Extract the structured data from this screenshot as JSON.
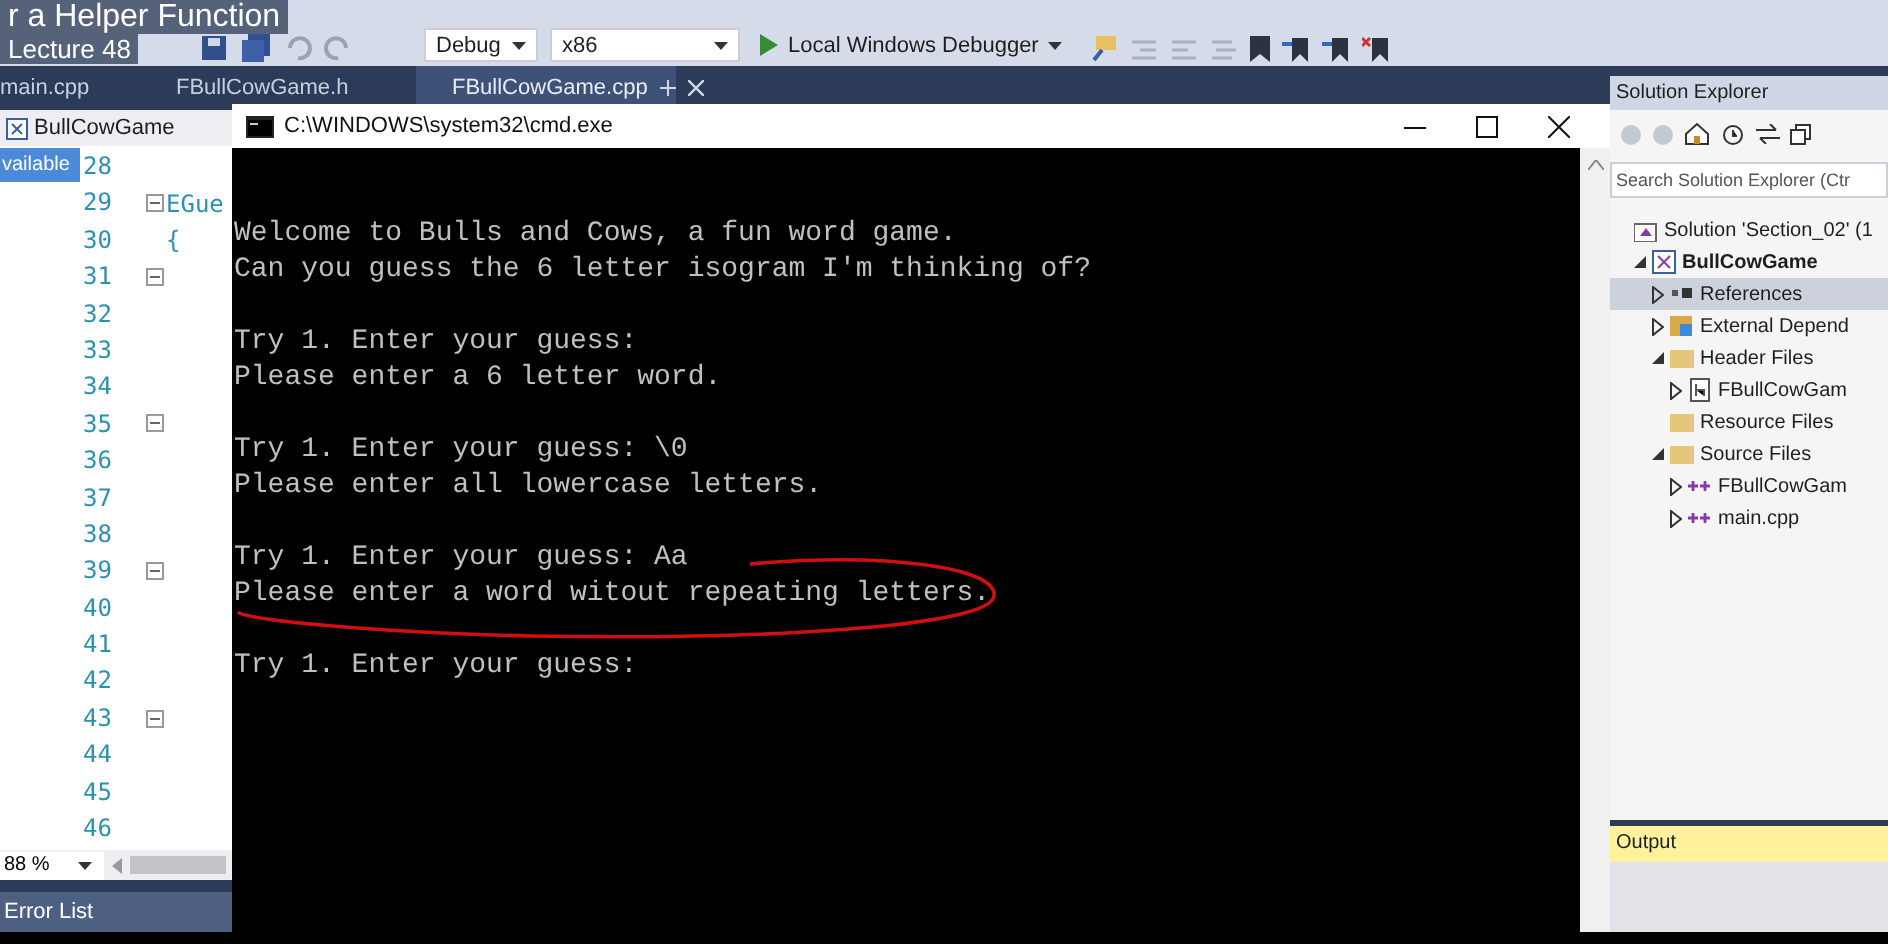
{
  "video_overlay": {
    "title": "r a Helper Function",
    "subtitle": "Lecture 48",
    "banner": "vailable"
  },
  "toolbar": {
    "configuration": "Debug",
    "platform": "x86",
    "debugger": "Local Windows Debugger"
  },
  "document_tabs": [
    {
      "label": "main.cpp",
      "selected": false
    },
    {
      "label": "FBullCowGame.h",
      "selected": false
    },
    {
      "label": "FBullCowGame.cpp",
      "selected": true
    }
  ],
  "editor": {
    "scope": "BullCowGame",
    "lines": [
      {
        "number": "28",
        "fold": false
      },
      {
        "number": "29",
        "fold": true,
        "code": "EGue"
      },
      {
        "number": "30",
        "fold": false,
        "code": "{"
      },
      {
        "number": "31",
        "fold": true
      },
      {
        "number": "32",
        "fold": false
      },
      {
        "number": "33",
        "fold": false
      },
      {
        "number": "34",
        "fold": false
      },
      {
        "number": "35",
        "fold": true
      },
      {
        "number": "36",
        "fold": false
      },
      {
        "number": "37",
        "fold": false
      },
      {
        "number": "38",
        "fold": false
      },
      {
        "number": "39",
        "fold": true
      },
      {
        "number": "40",
        "fold": false
      },
      {
        "number": "41",
        "fold": false
      },
      {
        "number": "42",
        "fold": false
      },
      {
        "number": "43",
        "fold": true
      },
      {
        "number": "44",
        "fold": false
      },
      {
        "number": "45",
        "fold": false
      },
      {
        "number": "46",
        "fold": false
      }
    ],
    "zoom": "88 %"
  },
  "error_list": {
    "title": "Error List"
  },
  "console": {
    "title": "C:\\WINDOWS\\system32\\cmd.exe",
    "paragraphs": [
      [
        {
          "text": "Welcome to Bulls and Cows, a fun word game.",
          "circled": false
        },
        {
          "text": "Can you guess the 6 letter isogram I'm thinking of?",
          "circled": false
        }
      ],
      [
        {
          "text": "Try 1. Enter your guess:",
          "circled": false
        },
        {
          "text": "Please enter a 6 letter word.",
          "circled": false
        }
      ],
      [
        {
          "text": "Try 1. Enter your guess: \\0",
          "circled": false
        },
        {
          "text": "Please enter all lowercase letters.",
          "circled": false
        }
      ],
      [
        {
          "text": "Try 1. Enter your guess: Aa",
          "circled": false
        },
        {
          "text": "Please enter a word witout repeating letters.",
          "circled": true
        }
      ],
      [
        {
          "text": "Try 1. Enter your guess:",
          "circled": false
        }
      ]
    ]
  },
  "solution_explorer": {
    "title": "Solution Explorer",
    "search": {
      "placeholder": "Search Solution Explorer (Ctr"
    },
    "tree": [
      {
        "label": "Solution 'Section_02' (1",
        "kind": "solution",
        "selected": false,
        "children": [
          {
            "label": "BullCowGame",
            "kind": "project",
            "expanded": true,
            "selected": false,
            "children": [
              {
                "label": "References",
                "kind": "references",
                "expanded": false,
                "selected": true
              },
              {
                "label": "External Depend",
                "kind": "external",
                "expanded": false,
                "selected": false
              },
              {
                "label": "Header Files",
                "kind": "folder",
                "expanded": true,
                "selected": false,
                "children": [
                  {
                    "label": "FBullCowGam",
                    "kind": "header",
                    "expanded": false,
                    "selected": false
                  }
                ]
              },
              {
                "label": "Resource Files",
                "kind": "folder",
                "selected": false
              },
              {
                "label": "Source Files",
                "kind": "folder",
                "expanded": true,
                "selected": false,
                "children": [
                  {
                    "label": "FBullCowGam",
                    "kind": "source",
                    "expanded": false,
                    "selected": false
                  },
                  {
                    "label": "main.cpp",
                    "kind": "source",
                    "expanded": false,
                    "selected": false
                  }
                ]
              }
            ]
          }
        ]
      }
    ]
  },
  "output": {
    "title": "Output"
  }
}
